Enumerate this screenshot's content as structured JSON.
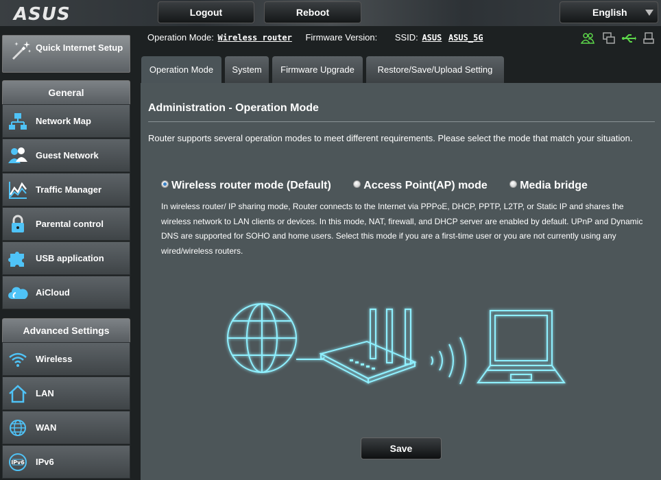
{
  "brand": {
    "logo_text": "ASUS"
  },
  "topbar": {
    "logout_label": "Logout",
    "reboot_label": "Reboot",
    "language_label": "English"
  },
  "sidebar": {
    "quick_setup_label": "Quick Internet Setup",
    "general_header": "General",
    "general_items": [
      {
        "label": "Network Map",
        "icon": "network-map-icon"
      },
      {
        "label": "Guest Network",
        "icon": "guest-network-icon"
      },
      {
        "label": "Traffic Manager",
        "icon": "traffic-manager-icon"
      },
      {
        "label": "Parental control",
        "icon": "lock-icon"
      },
      {
        "label": "USB application",
        "icon": "puzzle-icon"
      },
      {
        "label": "AiCloud",
        "icon": "cloud-icon"
      }
    ],
    "advanced_header": "Advanced Settings",
    "advanced_items": [
      {
        "label": "Wireless",
        "icon": "wifi-icon"
      },
      {
        "label": "LAN",
        "icon": "home-icon"
      },
      {
        "label": "WAN",
        "icon": "globe-icon"
      },
      {
        "label": "IPv6",
        "icon": "ipv6-icon"
      }
    ]
  },
  "header": {
    "operation_mode_label": "Operation Mode:",
    "operation_mode_value": "Wireless router",
    "firmware_label": "Firmware Version:",
    "ssid_label": "SSID:",
    "ssid_1": "ASUS",
    "ssid_2": "ASUS_5G"
  },
  "tabs": [
    {
      "label": "Operation Mode",
      "active": true
    },
    {
      "label": "System",
      "active": false
    },
    {
      "label": "Firmware Upgrade",
      "active": false
    },
    {
      "label": "Restore/Save/Upload Setting",
      "active": false
    }
  ],
  "main": {
    "title": "Administration - Operation Mode",
    "description": "Router supports several operation modes to meet different requirements. Please select the mode that match your situation.",
    "modes": [
      {
        "label": "Wireless router mode (Default)",
        "selected": true
      },
      {
        "label": "Access Point(AP) mode",
        "selected": false
      },
      {
        "label": "Media bridge",
        "selected": false
      }
    ],
    "mode_description": "In wireless router/ IP sharing mode, Router connects to the Internet via PPPoE, DHCP, PPTP, L2TP, or Static IP and shares the wireless network to LAN clients or devices. In this mode, NAT, firewall, and DHCP server are enabled by default. UPnP and Dynamic DNS are supported for SOHO and home users. Select this mode if you are a first-time user or you are not currently using any wired/wireless routers.",
    "save_label": "Save"
  },
  "colors": {
    "background": "#1d2122",
    "panel": "#4d5659",
    "status_green": "#5dd94a",
    "illustration_glow": "#8ff0ff"
  }
}
